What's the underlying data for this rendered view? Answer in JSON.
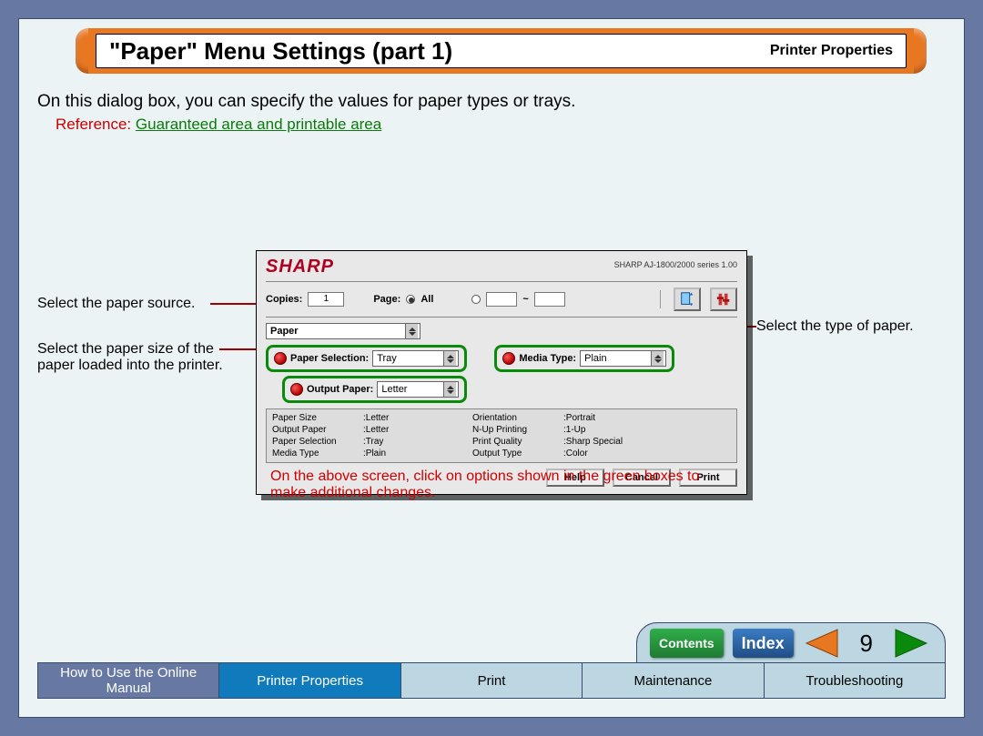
{
  "header": {
    "title": "\"Paper\" Menu Settings (part 1)",
    "subtitle": "Printer Properties"
  },
  "body": {
    "intro": "On this dialog box, you can specify the values for paper types or trays.",
    "reference_label": "Reference:",
    "reference_link": "Guaranteed area and printable area",
    "callout_source": "Select the paper source.",
    "callout_size": "Select the paper size of the paper loaded into the printer.",
    "callout_media": "Select the type of paper.",
    "hint": "On the above screen, click on options shown in the green boxes to make additional changes."
  },
  "dialog": {
    "brand": "SHARP",
    "model": "SHARP AJ-1800/2000 series 1.00",
    "copies_label": "Copies:",
    "copies_value": "1",
    "page_label": "Page:",
    "page_all": "All",
    "range_sep": "~",
    "tab_label": "Paper",
    "paper_selection_label": "Paper Selection:",
    "paper_selection_value": "Tray",
    "output_paper_label": "Output Paper:",
    "output_paper_value": "Letter",
    "media_type_label": "Media Type:",
    "media_type_value": "Plain",
    "status": {
      "paper_size_k": "Paper Size",
      "paper_size_v": ":Letter",
      "output_paper_k": "Output Paper",
      "output_paper_v": ":Letter",
      "paper_sel_k": "Paper Selection",
      "paper_sel_v": ":Tray",
      "media_type_k": "Media Type",
      "media_type_v": ":Plain",
      "orientation_k": "Orientation",
      "orientation_v": ":Portrait",
      "nup_k": "N-Up Printing",
      "nup_v": ":1-Up",
      "quality_k": "Print Quality",
      "quality_v": ":Sharp Special",
      "output_type_k": "Output Type",
      "output_type_v": ":Color"
    },
    "buttons": {
      "help": "Help",
      "cancel": "Cancel",
      "print": "Print"
    }
  },
  "pager": {
    "contents": "Contents",
    "index": "Index",
    "page": "9"
  },
  "tabs": {
    "manual": "How to Use the Online Manual",
    "printer": "Printer Properties",
    "print": "Print",
    "maintenance": "Maintenance",
    "trouble": "Troubleshooting"
  }
}
